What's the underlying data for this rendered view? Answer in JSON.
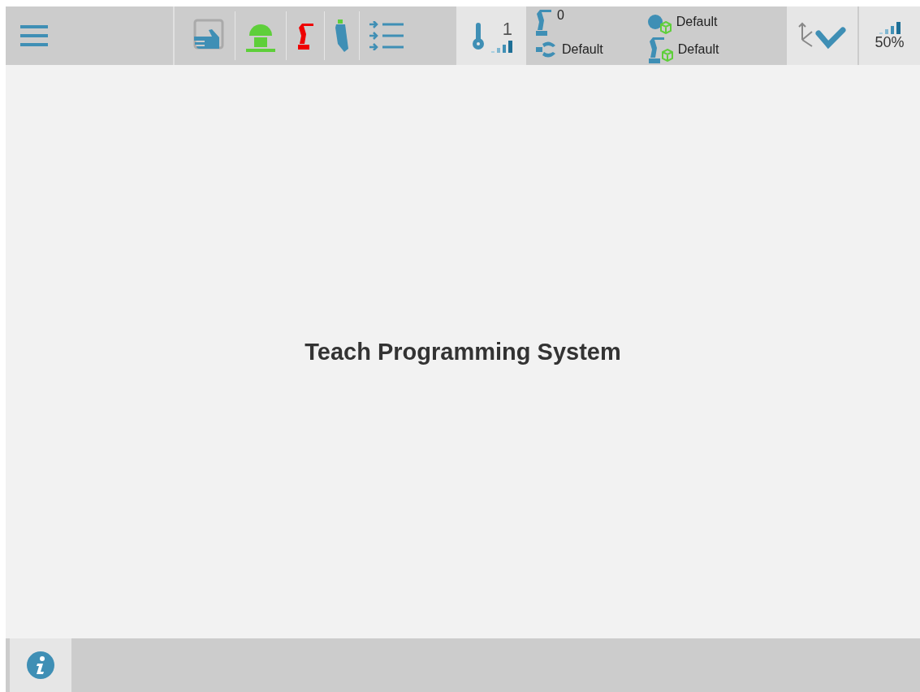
{
  "toolbar": {
    "user_level": "1",
    "tool_number": "0",
    "tool_frame": "Default",
    "work_object": "Default",
    "user_frame": "Default",
    "speed": "50%"
  },
  "main": {
    "title": "Teach Programming System"
  }
}
